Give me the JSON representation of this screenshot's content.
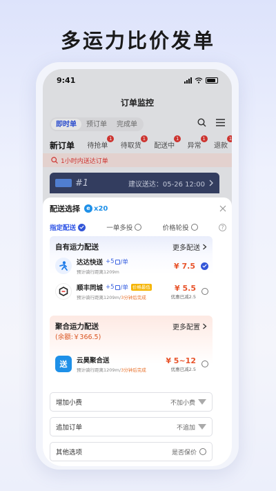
{
  "headline": "多运力比价发单",
  "status_bar": {
    "time": "9:41"
  },
  "page_title": "订单监控",
  "mode_tabs": [
    {
      "label": "即时单",
      "active": true
    },
    {
      "label": "预订单",
      "active": false
    },
    {
      "label": "完成单",
      "active": false
    }
  ],
  "status_tabs": [
    {
      "label": "新订单",
      "badge": "",
      "active": true
    },
    {
      "label": "待抢单",
      "badge": "1",
      "active": false
    },
    {
      "label": "待取货",
      "badge": "1",
      "active": false
    },
    {
      "label": "配送中",
      "badge": "1",
      "active": false
    },
    {
      "label": "异常",
      "badge": "1",
      "active": false
    },
    {
      "label": "退款",
      "badge": "1",
      "active": false
    }
  ],
  "notice": "1小时内送达订单",
  "order_card": {
    "number": "#1",
    "suggest": "建议送达：05-26  12:00"
  },
  "sheet": {
    "title": "配送选择",
    "coin_symbol": "e",
    "coin_count": "x20",
    "modes": [
      {
        "label": "指定配送",
        "active": true
      },
      {
        "label": "一单多投",
        "active": false
      },
      {
        "label": "价格轮投",
        "active": false
      }
    ],
    "help_symbol": "?",
    "own": {
      "title": "自有运力配送",
      "more": "更多配送",
      "carriers": [
        {
          "name": "达达快送",
          "extra": "+5",
          "extra_unit": "/单",
          "tag": "",
          "sub": "预计骑行距离1209m",
          "sub_highlight": "",
          "price": "¥ 7.5",
          "discount": "",
          "selected": true
        },
        {
          "name": "顺丰同城",
          "extra": "+5",
          "extra_unit": "/单",
          "tag": "价格最低",
          "sub": "预计骑行距离1209m/",
          "sub_highlight": "3分钟后完成",
          "price": "¥ 5.5",
          "discount": "优惠已减2.5",
          "selected": false
        }
      ]
    },
    "aggregate": {
      "title": "聚合运力配送",
      "more": "更多配置",
      "balance": "(余额:￥366.5)",
      "carrier": {
        "name": "云昊聚合送",
        "logo_text": "送",
        "sub": "预计骑行距离1209m/",
        "sub_highlight": "3分钟后完成",
        "price": "¥ 5~12",
        "discount": "优惠已减2.5",
        "selected": false
      }
    },
    "options": [
      {
        "label": "增加小费",
        "value": "不加小费",
        "control": "caret"
      },
      {
        "label": "追加订单",
        "value": "不追加",
        "control": "caret"
      },
      {
        "label": "其他选项",
        "value": "是否保价",
        "control": "radio"
      }
    ]
  },
  "colors": {
    "accent": "#2f55e6",
    "price": "#e8532a",
    "badge": "#e53935",
    "coin": "#1e90e8"
  }
}
